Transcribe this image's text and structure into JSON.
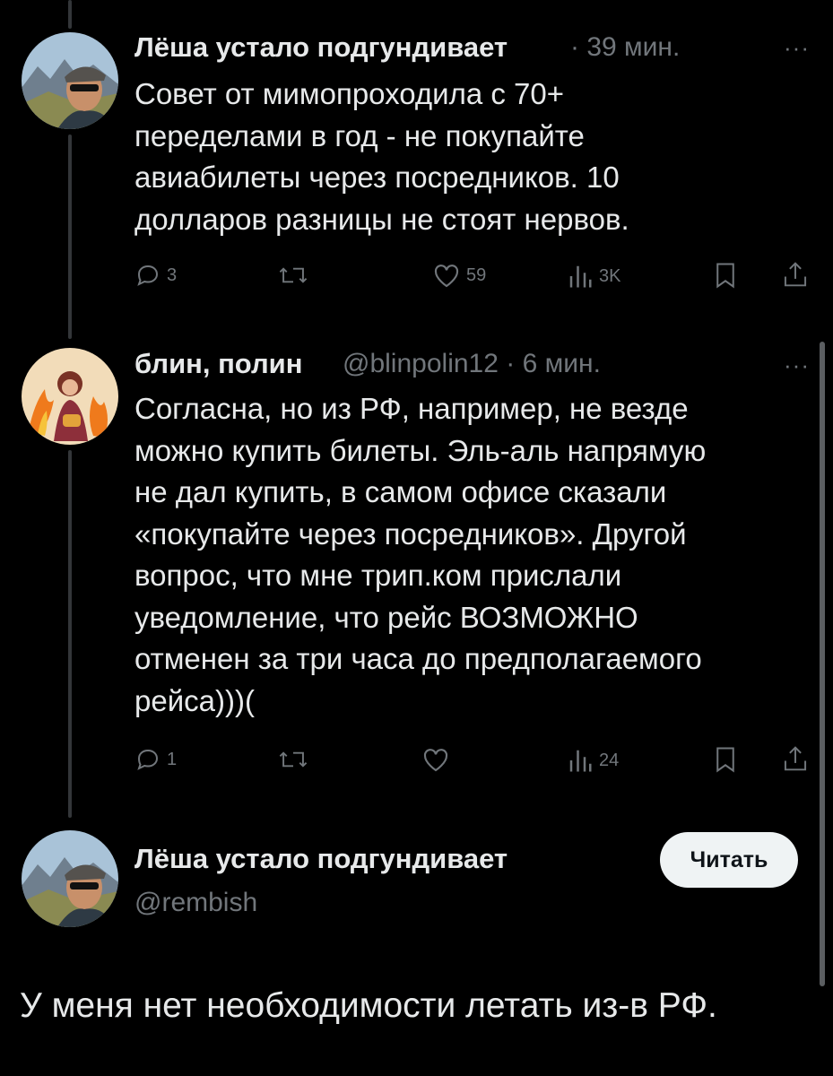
{
  "tweets": [
    {
      "author": "Лёша устало подгундивает",
      "dot": "·",
      "time": "39 мин.",
      "more": "···",
      "text": "Совет от мимопроходила с 70+\nпеределами в год - не покупайте\nавиабилеты через посредников. 10\nдолларов разницы не стоят нервов.",
      "replies": "3",
      "retweets": "",
      "likes": "59",
      "views": "3K"
    },
    {
      "author": "блин, полин",
      "handle": "@blinpolin12",
      "dot": "·",
      "time": "6 мин.",
      "more": "···",
      "text": "Согласна, но из РФ, например, не везде\nможно купить билеты. Эль-аль напрямую\nне дал купить, в самом офисе сказали\n«покупайте через посредников». Другой\nвопрос, что мне трип.ком прислали\nуведомление, что рейс ВОЗМОЖНО\nотменен за три часа до предполагаемого\nрейса)))(",
      "replies": "1",
      "retweets": "",
      "likes": "",
      "views": "24"
    }
  ],
  "main_post": {
    "author": "Лёша устало подгундивает",
    "handle": "@rembish",
    "follow_label": "Читать",
    "text": "У меня нет необходимости летать из-в РФ."
  },
  "icons": {
    "reply": "reply-icon",
    "retweet": "retweet-icon",
    "like": "heart-icon",
    "views": "views-icon",
    "bookmark": "bookmark-icon",
    "share": "share-icon"
  },
  "colors": {
    "background": "#000000",
    "text": "#e7e9ea",
    "secondary": "#71767b",
    "button_bg": "#eff3f4"
  }
}
